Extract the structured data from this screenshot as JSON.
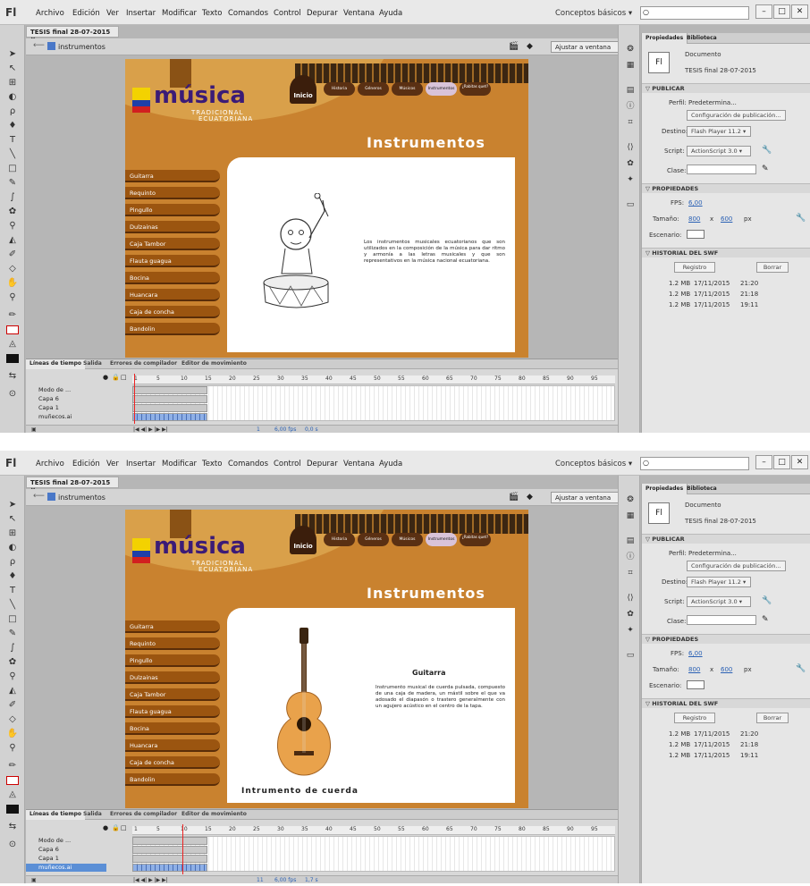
{
  "app": {
    "logo": "Fl",
    "menu": [
      "Archivo",
      "Edición",
      "Ver",
      "Insertar",
      "Modificar",
      "Texto",
      "Comandos",
      "Control",
      "Depurar",
      "Ventana",
      "Ayuda"
    ],
    "workspace": "Conceptos básicos",
    "workspace_arrow": "▾",
    "win_min": "–",
    "win_max": "□",
    "win_close": "✕"
  },
  "document": {
    "tab": "TESIS final 28-07-2015",
    "tab_close": "×",
    "breadcrumb": "instrumentos",
    "zoom": "Ajustar a ventana"
  },
  "site": {
    "brand": "música",
    "brand_sub1": "TRADICIONAL",
    "brand_sub2": "ECUATORIANA",
    "home": "Inicio",
    "nav": [
      "Historia",
      "Géneros",
      "Músicos",
      "Instrumentos",
      "¿Rabitas quet?"
    ],
    "page_title": "Instrumentos",
    "menu": [
      "Guitarra",
      "Requinto",
      "Pingullo",
      "Dulzainas",
      "Caja Tambor",
      "Flauta guagua",
      "Bocina",
      "Huancara",
      "Caja de concha",
      "Bandolin"
    ]
  },
  "screens": [
    {
      "intro_text": "Los instrumentos musicales ecuatorianos que son utilizados en la composición de la música para dar ritmo y armonía a las letras musicales y que son representativos en la música nacional ecuatoriana.",
      "frame_num": "1",
      "fps": "6,00 fps",
      "time": "0,0 s",
      "selected_layer": false
    },
    {
      "guitar_title": "Guitarra",
      "guitar_text": "Instrumento musical de cuerda pulsada, compuesto de una caja de madera, un mástil sobre el que va adosado el diapasón o trastero generalmente con un agujero acústico en el centro de la tapa.",
      "footer": "Intrumento de cuerda",
      "frame_num": "11",
      "fps": "6,00 fps",
      "time": "1,7 s",
      "selected_layer": true
    }
  ],
  "properties": {
    "tab_props": "Propiedades",
    "tab_lib": "Biblioteca",
    "doc_icon": "Fl",
    "doc_label": "Documento",
    "doc_name": "TESIS final 28-07-2015",
    "sec_publicar": "▽ PUBLICAR",
    "perfil_label": "Perfil:",
    "perfil_value": "Predetermina...",
    "config_btn": "Configuración de publicación...",
    "destino_label": "Destino:",
    "destino_value": "Flash Player 11.2",
    "script_label": "Script:",
    "script_value": "ActionScript 3.0",
    "clase_label": "Clase:",
    "sec_propiedades": "▽ PROPIEDADES",
    "fps_label": "FPS:",
    "fps_value": "6,00",
    "tamano_label": "Tamaño:",
    "width": "800",
    "x": "x",
    "height": "600",
    "unit": "px",
    "escenario_label": "Escenario:",
    "sec_historial": "▽ HISTORIAL DEL SWF",
    "registro_btn": "Registro",
    "borrar_btn": "Borrar",
    "history": [
      {
        "size": "1.2 MB",
        "date": "17/11/2015",
        "time": "21:20"
      },
      {
        "size": "1.2 MB",
        "date": "17/11/2015",
        "time": "21:18"
      },
      {
        "size": "1.2 MB",
        "date": "17/11/2015",
        "time": "19:11"
      }
    ]
  },
  "timeline": {
    "tabs": [
      "Líneas de tiempo",
      "Salida",
      "Errores de compilador",
      "Editor de movimiento"
    ],
    "layers": [
      "Modo de ...",
      "Capa 6",
      "Capa 1",
      "muñecos.ai"
    ],
    "ruler": [
      "1",
      "5",
      "10",
      "15",
      "20",
      "25",
      "30",
      "35",
      "40",
      "45",
      "50",
      "55",
      "60",
      "65",
      "70",
      "75",
      "80",
      "85",
      "90",
      "95"
    ]
  },
  "colors": {
    "stage_bg": "#c9822f",
    "brand_purple": "#3b1b77",
    "menu_brown": "#9b5510",
    "selection_blue": "#5b8fd6"
  }
}
